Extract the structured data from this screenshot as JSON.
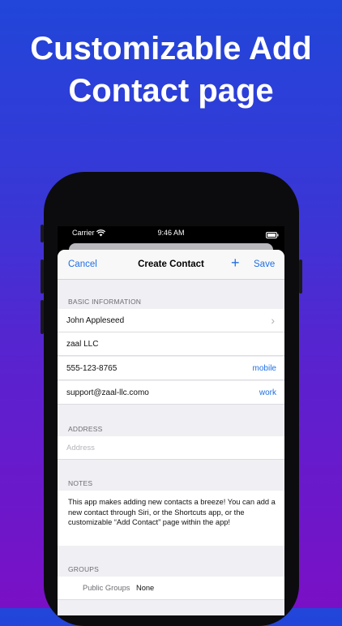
{
  "headline": {
    "line1": "Customizable Add",
    "line2": "Contact page"
  },
  "status_bar": {
    "carrier": "Carrier",
    "time": "9:46 AM"
  },
  "nav": {
    "cancel": "Cancel",
    "title": "Create Contact",
    "plus": "+",
    "save": "Save"
  },
  "basic_info": {
    "header": "BASIC INFORMATION",
    "name": "John Appleseed",
    "company": "zaal LLC",
    "phone": "555-123-8765",
    "phone_label": "mobile",
    "email": "support@zaal-llc.como",
    "email_label": "work"
  },
  "address": {
    "header": "ADDRESS",
    "placeholder": "Address"
  },
  "notes": {
    "header": "NOTES",
    "text": "This app makes adding new contacts a breeze! You can add a new contact through Siri, or the Shortcuts app, or the customizable “Add Contact” page within the app!"
  },
  "groups": {
    "header": "GROUPS",
    "label": "Public Groups",
    "value": "None"
  },
  "colors": {
    "accent": "#1f6fe5",
    "background_top": "#2146d9",
    "background_bottom": "#7a10c6"
  }
}
